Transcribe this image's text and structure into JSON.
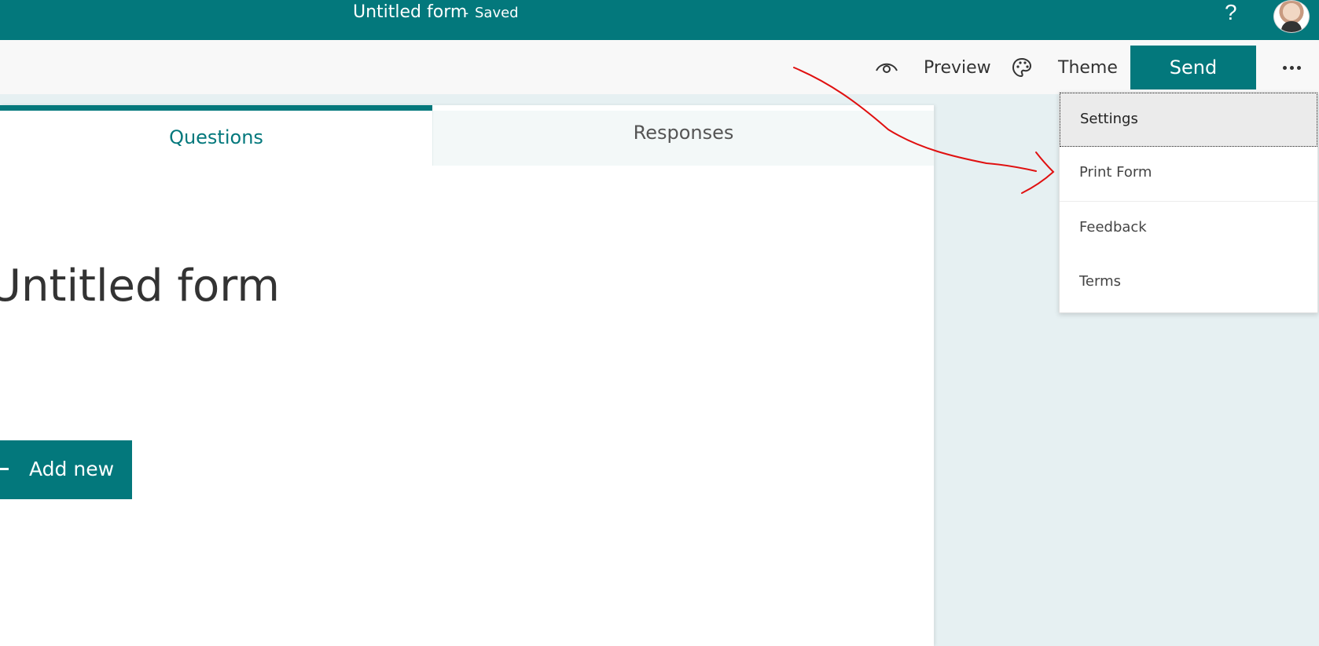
{
  "header": {
    "title": "Untitled form",
    "separator": "-",
    "status": "Saved",
    "help_glyph": "?",
    "icons": {
      "help": "help-icon",
      "avatar": "avatar"
    }
  },
  "toolbar": {
    "preview_label": "Preview",
    "theme_label": "Theme",
    "send_label": "Send",
    "icons": {
      "preview": "eye-icon",
      "theme": "palette-icon",
      "more": "more-icon"
    }
  },
  "tabs": [
    {
      "label": "Questions",
      "active": true
    },
    {
      "label": "Responses",
      "active": false
    }
  ],
  "form": {
    "title": "Untitled form",
    "add_new_label": "Add new"
  },
  "more_menu": {
    "items": [
      {
        "label": "Settings",
        "focused": true
      },
      {
        "label": "Print Form"
      },
      {
        "label": "Feedback"
      },
      {
        "label": "Terms"
      }
    ]
  },
  "colors": {
    "brand": "#03787c",
    "annotation": "#e01010",
    "page_background": "#e6f0f2"
  }
}
